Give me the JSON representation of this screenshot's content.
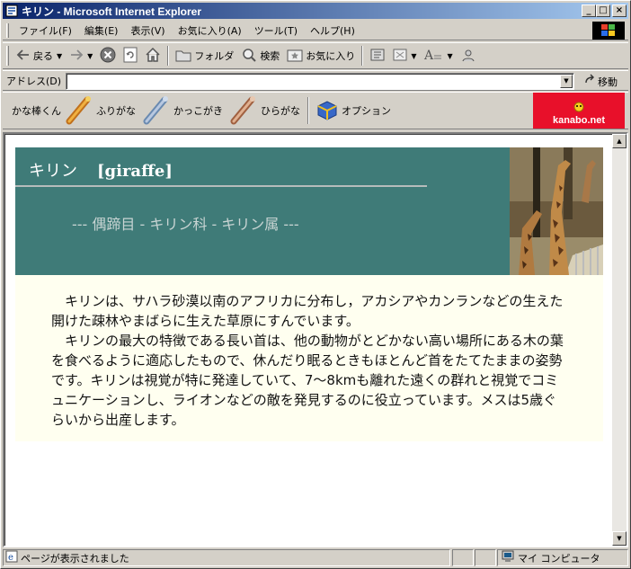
{
  "window": {
    "title": "キリン - Microsoft Internet Explorer",
    "buttons": {
      "minimize": "_",
      "maximize": "□",
      "close": "×"
    }
  },
  "menu": {
    "items": [
      "ファイル(F)",
      "編集(E)",
      "表示(V)",
      "お気に入り(A)",
      "ツール(T)",
      "ヘルプ(H)"
    ]
  },
  "toolbar": {
    "back": "戻る",
    "folder": "フォルダ",
    "search": "検索",
    "favorites": "お気に入り"
  },
  "address": {
    "label": "アドレス(D)",
    "value": "",
    "go": "移動"
  },
  "kanabo": {
    "title": "かな棒くん",
    "furigana": "ふりがな",
    "kakkogaki": "かっこがき",
    "hiragana": "ひらがな",
    "option": "オプション",
    "logo": "kanabo.net"
  },
  "page": {
    "title_ja": "キリン",
    "title_en": "[giraffe]",
    "classification": "--- 偶蹄目 - キリン科 - キリン属 ---",
    "paragraph1": "キリンは、サハラ砂漠以南のアフリカに分布し，アカシアやカンランなどの生えた開けた疎林やまばらに生えた草原にすんでいます。",
    "paragraph2": "キリンの最大の特徴である長い首は、他の動物がとどかない高い場所にある木の葉を食べるように適応したもので、休んだり眠るときもほとんど首をたてたままの姿勢です。キリンは視覚が特に発達していて、7～8kmも離れた遠くの群れと視覚でコミュニケーションし、ライオンなどの敵を発見するのに役立っています。メスは5歳ぐらいから出産します。"
  },
  "status": {
    "message": "ページが表示されました",
    "zone": "マイ コンピュータ"
  },
  "colors": {
    "banner": "#3f7b78",
    "body_bg": "#fffff0",
    "titlebar_start": "#0a246a",
    "titlebar_end": "#a6caf0",
    "kanabo_logo": "#e8102a"
  }
}
